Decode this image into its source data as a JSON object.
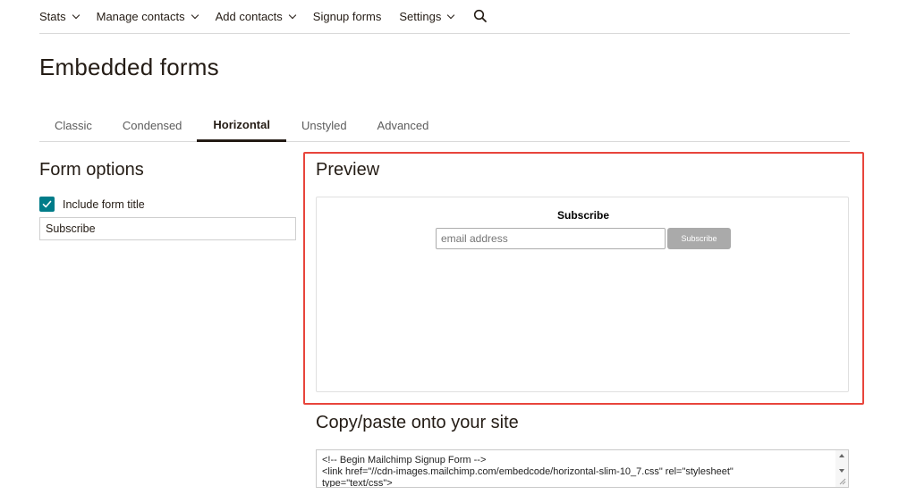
{
  "nav": {
    "items": [
      {
        "label": "Stats",
        "has_dropdown": true
      },
      {
        "label": "Manage contacts",
        "has_dropdown": true
      },
      {
        "label": "Add contacts",
        "has_dropdown": true
      },
      {
        "label": "Signup forms",
        "has_dropdown": false
      },
      {
        "label": "Settings",
        "has_dropdown": true
      }
    ],
    "search_icon": "search-icon"
  },
  "page": {
    "title": "Embedded forms"
  },
  "tabs": [
    {
      "label": "Classic",
      "active": false
    },
    {
      "label": "Condensed",
      "active": false
    },
    {
      "label": "Horizontal",
      "active": true
    },
    {
      "label": "Unstyled",
      "active": false
    },
    {
      "label": "Advanced",
      "active": false
    }
  ],
  "form_options": {
    "heading": "Form options",
    "include_title_label": "Include form title",
    "include_title_checked": true,
    "title_value": "Subscribe"
  },
  "preview": {
    "heading": "Preview",
    "form_title": "Subscribe",
    "email_placeholder": "email address",
    "submit_label": "Subscribe"
  },
  "copy_paste": {
    "heading": "Copy/paste onto your site",
    "code_lines": [
      "<!-- Begin Mailchimp Signup Form -->",
      "<link href=\"//cdn-images.mailchimp.com/embedcode/horizontal-slim-10_7.css\" rel=\"stylesheet\"",
      "type=\"text/css\">"
    ]
  },
  "colors": {
    "accent": "#007c89",
    "highlight": "#e8453c",
    "text": "#241c15",
    "submit_button": "#aaaaaa"
  }
}
